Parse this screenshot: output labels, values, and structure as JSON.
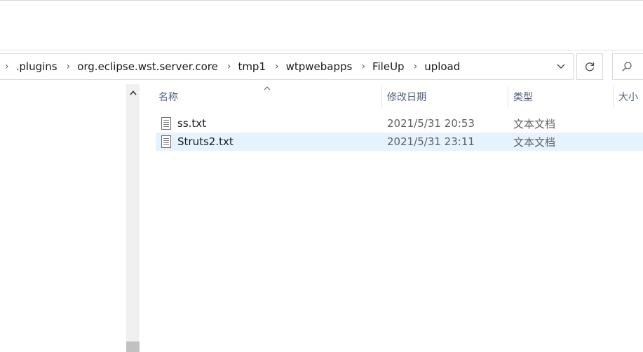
{
  "breadcrumb": {
    "items": [
      ".plugins",
      "org.eclipse.wst.server.core",
      "tmp1",
      "wtpwebapps",
      "FileUp",
      "upload"
    ]
  },
  "columns": {
    "name": "名称",
    "date_modified": "修改日期",
    "type": "类型",
    "size": "大小"
  },
  "files": [
    {
      "name": "ss.txt",
      "date_modified": "2021/5/31 20:53",
      "type": "文本文档",
      "icon": "text-file-icon",
      "selected": false
    },
    {
      "name": "Struts2.txt",
      "date_modified": "2021/5/31 23:11",
      "type": "文本文档",
      "icon": "text-file-icon",
      "selected": true
    }
  ],
  "colors": {
    "selection": "#e5f3ff",
    "header_text": "#4c607a",
    "border": "#d9d9d9"
  }
}
